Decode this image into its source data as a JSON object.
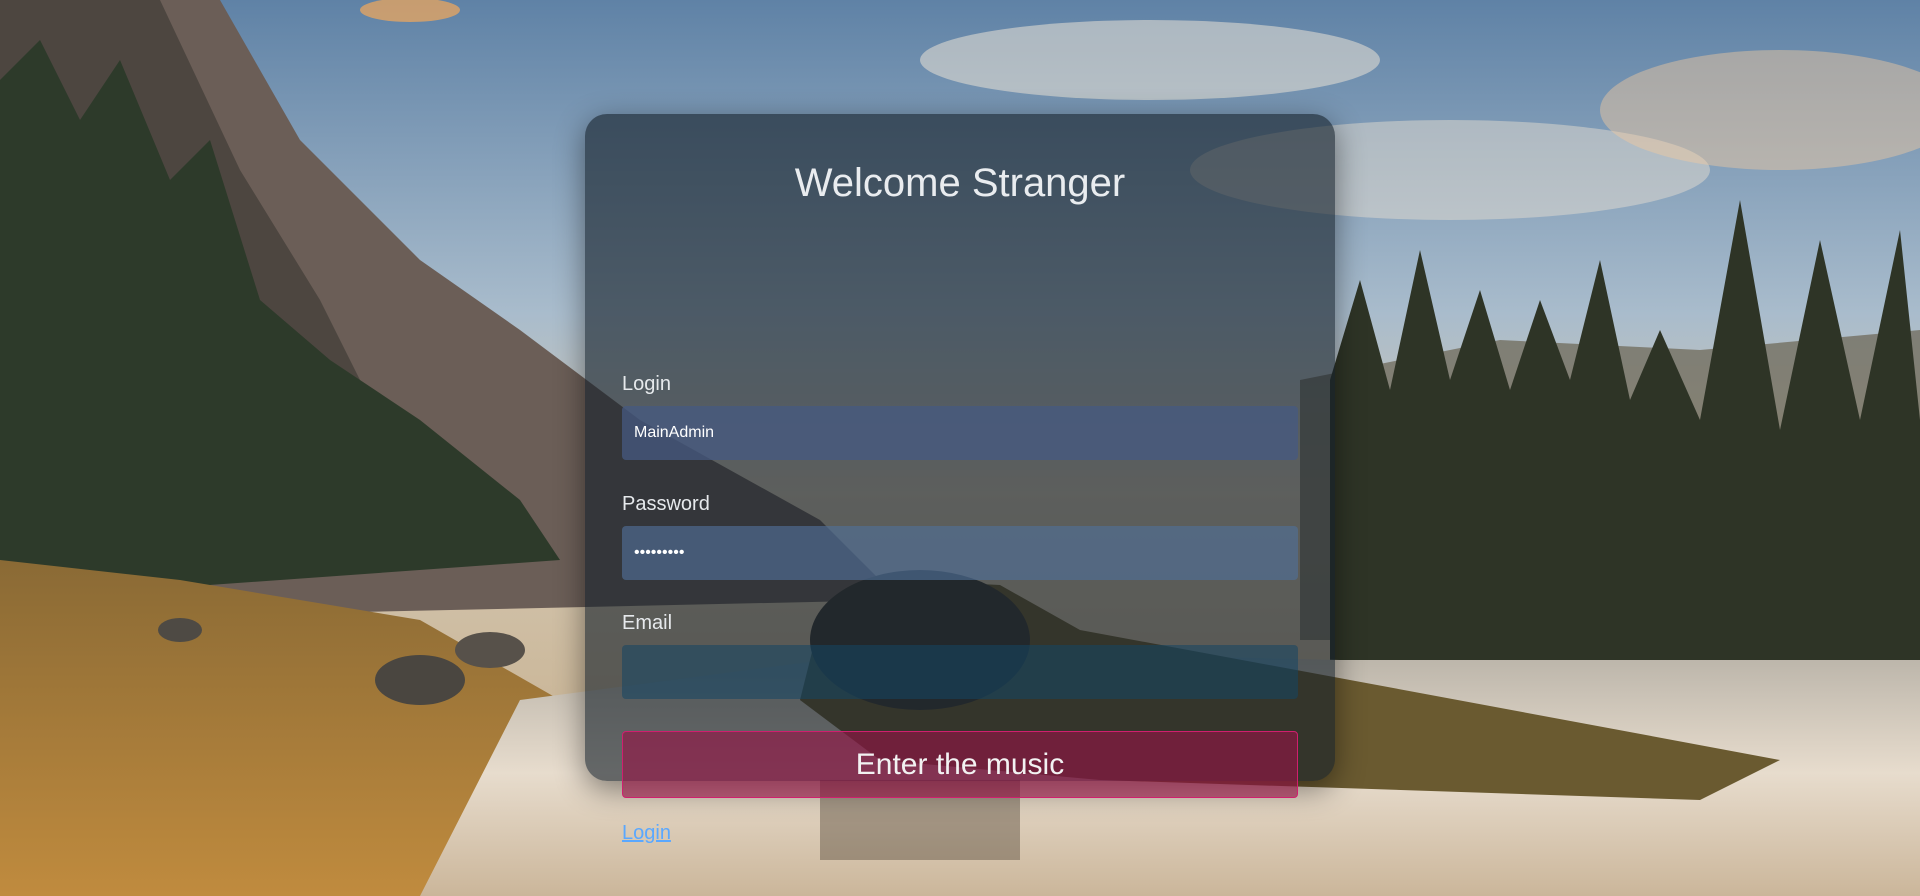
{
  "page": {
    "title": "Welcome Stranger"
  },
  "form": {
    "login_label": "Login",
    "login_value": "MainAdmin",
    "password_label": "Password",
    "password_value": "•••••••••",
    "email_label": "Email",
    "email_value": "",
    "submit_label": "Enter the music",
    "login_link": "Login"
  },
  "colors": {
    "card_background": "#1e2a36",
    "button_border": "#d01f6e",
    "button_fill": "#961446",
    "link": "#5aa8ff"
  }
}
